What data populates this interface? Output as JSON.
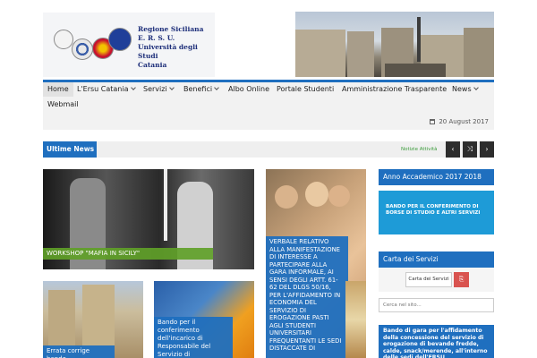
{
  "header": {
    "logo_lines": [
      "Regione Siciliana",
      "E. R. S. U.",
      "Università degli Studi",
      "Catania"
    ]
  },
  "nav": {
    "items": [
      {
        "label": "Home",
        "dropdown": false
      },
      {
        "label": "L'Ersu Catania",
        "dropdown": true
      },
      {
        "label": "Servizi",
        "dropdown": true
      },
      {
        "label": "Benefici",
        "dropdown": true
      },
      {
        "label": "Albo Online",
        "dropdown": false
      },
      {
        "label": "Portale Studenti",
        "dropdown": false
      },
      {
        "label": "Amministrazione Trasparente",
        "dropdown": false
      },
      {
        "label": "News",
        "dropdown": true
      },
      {
        "label": "Webmail",
        "dropdown": false
      }
    ],
    "date": "20 August 2017"
  },
  "news_bar": {
    "label": "Ultime News",
    "ticker": "Notizie Attività",
    "prev": "‹",
    "shuffle": "⤨",
    "next": "›"
  },
  "articles": {
    "a1": "WORKSHOP \"MAFIA IN SICILY\"",
    "a2": "VERBALE RELATIVO ALLA MANIFESTAZIONE DI INTERESSE A PARTECIPARE ALLA GARA INFORMALE, AI SENSI DEGLI ARTT. 61-62 DEL DLGS 50/16, PER L'AFFIDAMENTO IN ECONOMIA DEL SERVIZIO DI EROGAZIONE PASTI AGLI STUDENTI UNIVERSITARI FREQUENTANTI LE SEDI DISTACCATE DI",
    "a3": "Errata corrige bando",
    "a4": "Bando per il conferimento dell'incarico di Responsabile del Servizio di"
  },
  "sidebar": {
    "anno_title": "Anno Accademico 2017 2018",
    "anno_box": "BANDO PER IL CONFERIMENTO DI BORSE DI STUDIO E ALTRI SERVIZI",
    "carta_title": "Carta dei Servizi",
    "carta_button": "Carta dei Servizi",
    "search_placeholder": "Cerca nel sito...",
    "bando_text": "Bando di gara per l'affidamento della concessione del servizio di erogazione di bevande fredde, calde, snack/merende, all'interno delle sedi dell'ERSU"
  }
}
